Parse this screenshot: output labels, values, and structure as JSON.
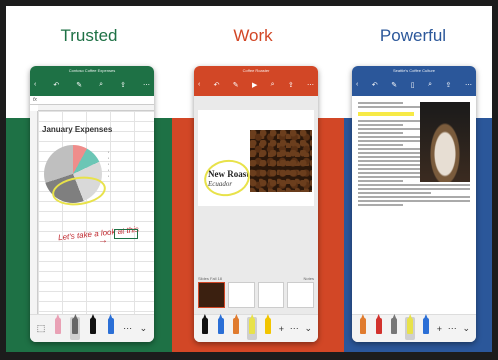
{
  "headings": {
    "left": "Trusted",
    "middle": "Work",
    "right": "Powerful"
  },
  "colors": {
    "excel": "#1e7145",
    "powerpoint": "#d24726",
    "word": "#2b579a",
    "highlighter": "#e8e24a"
  },
  "excel": {
    "doc_title": "Contoso Coffee Expenses",
    "formula_label": "fx",
    "chart_title": "January Expenses",
    "ink_note": "Let's take a look at this"
  },
  "powerpoint": {
    "doc_title": "Coffee Roaster",
    "slide_title": "New Roast",
    "slide_subtitle": "Ecuador",
    "thumbs_label": "Slides Fall 18",
    "notes_label": "Notes"
  },
  "word": {
    "doc_title": "Seattle's Coffee Culture"
  },
  "icons": {
    "back": "chevron-left-icon",
    "undo": "undo-icon",
    "search": "search-icon",
    "share": "share-icon",
    "more": "more-icon",
    "play": "play-icon"
  }
}
